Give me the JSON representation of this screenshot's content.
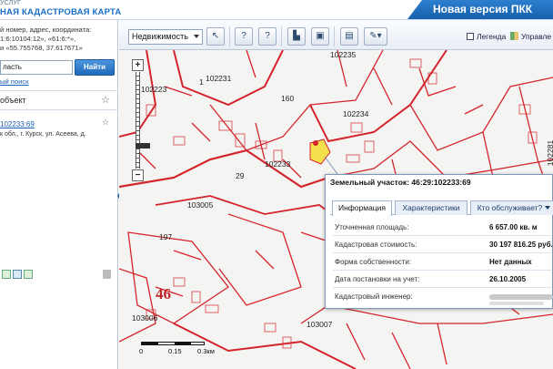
{
  "header": {
    "brand_top": "УСЛУГ",
    "brand_title": "НАЯ КАДАСТРОВАЯ КАРТА",
    "new_version": "Новая версия ПКК"
  },
  "left_panel": {
    "hint_lines": [
      "й номер, адрес, координата:",
      "1:6:10104:12», «61:6:*»,",
      "и «55.755768, 37.617671»"
    ],
    "search_value": "ласть",
    "find_label": "Найти",
    "advanced_link": "ый поиск",
    "objects_header": "объект",
    "object_link": "102233:69",
    "object_address": [
      "к обл., г. Курск, ул. Асеева, д."
    ]
  },
  "toolbar": {
    "layer_select": "Недвижимость",
    "legend_label": "Легенда",
    "manage_label": "Управле"
  },
  "map": {
    "labels": [
      {
        "text": "102231"
      },
      {
        "text": "102223"
      },
      {
        "text": "160"
      },
      {
        "text": "102235"
      },
      {
        "text": "102234"
      },
      {
        "text": "102233"
      },
      {
        "text": "102281"
      },
      {
        "text": "103005"
      },
      {
        "text": "197"
      },
      {
        "text": "29"
      },
      {
        "text": "103006"
      },
      {
        "text": "103007"
      },
      {
        "text": "1"
      }
    ],
    "region_number": "46",
    "scale_labels": [
      "0",
      "0.15",
      "0.3км"
    ]
  },
  "popup": {
    "title": "Земельный участок: 46:29:102233:69",
    "tabs": [
      "Информация",
      "Характеристики",
      "Кто обслуживает?"
    ],
    "rows": [
      {
        "key": "Уточненная площадь:",
        "value": "6 657.00 кв. м"
      },
      {
        "key": "Кадастровая стоимость:",
        "value": "30 197 816.25 руб."
      },
      {
        "key": "Форма собственности:",
        "value": "Нет данных"
      },
      {
        "key": "Дата постановки на учет:",
        "value": "26.10.2005"
      },
      {
        "key": "Кадастровый инженер:",
        "value": ""
      }
    ]
  },
  "colors": {
    "accent": "#1a6fc4",
    "parcel_line": "#d4242c",
    "highlight": "#f4e04d"
  }
}
